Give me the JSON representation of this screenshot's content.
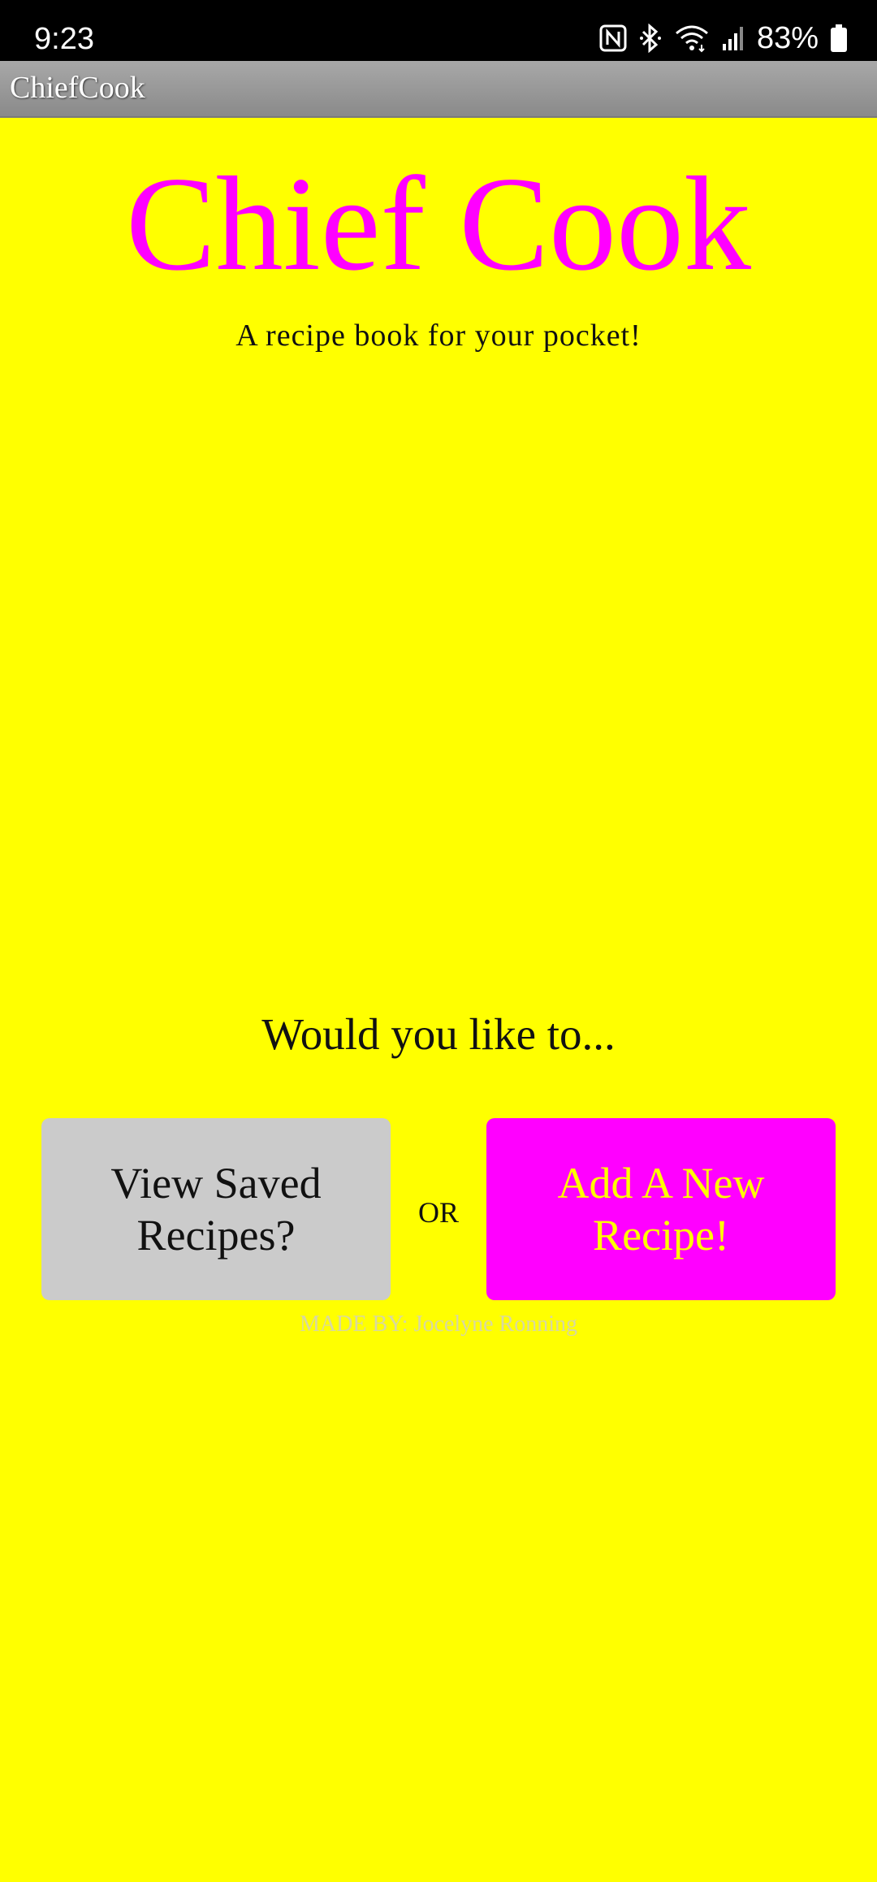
{
  "status_bar": {
    "time": "9:23",
    "battery_percent": "83%",
    "icons": [
      "nfc-icon",
      "bluetooth-icon",
      "wifi-icon",
      "signal-icon",
      "battery-icon"
    ]
  },
  "app_bar": {
    "title": "ChiefCook"
  },
  "main": {
    "title": "Chief Cook",
    "subtitle": "A recipe book for your pocket!",
    "prompt": "Would you like to...",
    "view_button_label": "View Saved Recipes?",
    "or_label": "OR",
    "add_button_label": "Add A New Recipe!",
    "credit": "MADE BY: Jocelyne Ronning"
  },
  "colors": {
    "background": "#ffff00",
    "title": "#ff00ff",
    "view_button": "#cbcbcb",
    "add_button": "#ff00ff",
    "add_button_text": "#ffff00"
  }
}
